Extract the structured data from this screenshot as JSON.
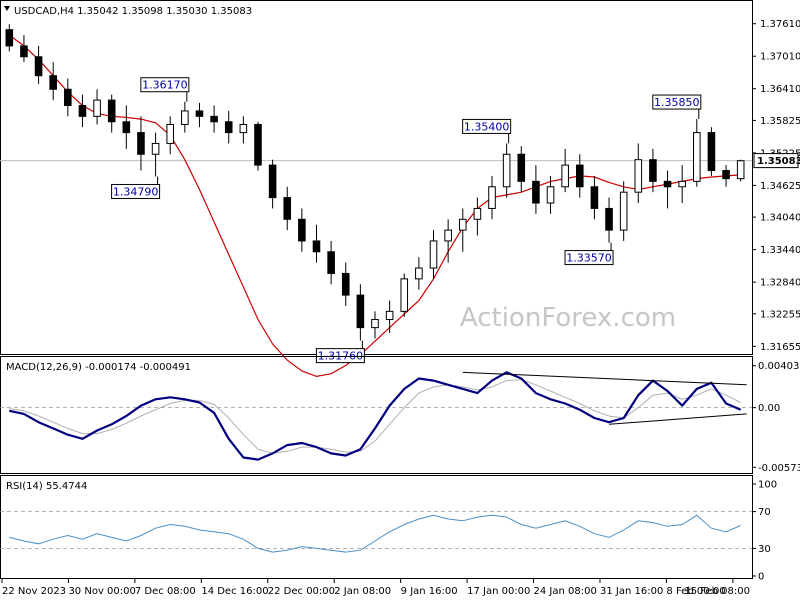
{
  "header": {
    "symbol_line": "USDCAD,H4  1.35042 1.35098 1.35030 1.35083"
  },
  "watermark": "ActionForex.com",
  "colors": {
    "ma": "#cc0000",
    "macd": "#000080",
    "signal": "#b0b0b0",
    "rsi": "#4a90c8",
    "trend": "#000000"
  },
  "chart_data": [
    {
      "type": "candlestick",
      "pane": "price",
      "ylim": [
        1.3155,
        1.379
      ],
      "y_ticks": [
        "1.37610",
        "1.37010",
        "1.36410",
        "1.35825",
        "1.35225",
        "1.34625",
        "1.34040",
        "1.33440",
        "1.32840",
        "1.32255",
        "1.31655"
      ],
      "current_price_label": "1.35083",
      "current_price": 1.35083,
      "series": [
        {
          "name": "Moving Average",
          "color": "#cc0000",
          "values": [
            1.374,
            1.372,
            1.3695,
            1.3665,
            1.3635,
            1.361,
            1.3595,
            1.359,
            1.3588,
            1.3585,
            1.3578,
            1.3555,
            1.351,
            1.3455,
            1.3395,
            1.3335,
            1.3275,
            1.3215,
            1.317,
            1.314,
            1.312,
            1.311,
            1.3115,
            1.313,
            1.315,
            1.3175,
            1.32,
            1.3225,
            1.325,
            1.329,
            1.334,
            1.3385,
            1.342,
            1.344,
            1.3445,
            1.345,
            1.346,
            1.347,
            1.3475,
            1.348,
            1.3478,
            1.3468,
            1.346,
            1.3455,
            1.346,
            1.3465,
            1.347,
            1.3475,
            1.3478,
            1.348,
            1.3482
          ]
        }
      ],
      "candles": [
        [
          1.375,
          1.376,
          1.371,
          1.372
        ],
        [
          1.372,
          1.374,
          1.369,
          1.37
        ],
        [
          1.37,
          1.372,
          1.365,
          1.3665
        ],
        [
          1.3665,
          1.369,
          1.362,
          1.364
        ],
        [
          1.364,
          1.366,
          1.359,
          1.361
        ],
        [
          1.361,
          1.363,
          1.357,
          1.359
        ],
        [
          1.359,
          1.364,
          1.3575,
          1.362
        ],
        [
          1.362,
          1.363,
          1.356,
          1.358
        ],
        [
          1.358,
          1.361,
          1.353,
          1.356
        ],
        [
          1.356,
          1.359,
          1.349,
          1.352
        ],
        [
          1.352,
          1.356,
          1.3479,
          1.354
        ],
        [
          1.354,
          1.359,
          1.352,
          1.3575
        ],
        [
          1.3575,
          1.3617,
          1.356,
          1.36
        ],
        [
          1.36,
          1.3615,
          1.357,
          1.359
        ],
        [
          1.359,
          1.361,
          1.356,
          1.358
        ],
        [
          1.358,
          1.36,
          1.354,
          1.356
        ],
        [
          1.356,
          1.359,
          1.354,
          1.3575
        ],
        [
          1.3575,
          1.358,
          1.349,
          1.35
        ],
        [
          1.35,
          1.351,
          1.342,
          1.344
        ],
        [
          1.344,
          1.346,
          1.338,
          1.34
        ],
        [
          1.34,
          1.342,
          1.334,
          1.336
        ],
        [
          1.336,
          1.339,
          1.332,
          1.334
        ],
        [
          1.334,
          1.336,
          1.328,
          1.33
        ],
        [
          1.33,
          1.332,
          1.324,
          1.326
        ],
        [
          1.326,
          1.328,
          1.3176,
          1.32
        ],
        [
          1.32,
          1.323,
          1.318,
          1.3215
        ],
        [
          1.3215,
          1.325,
          1.319,
          1.323
        ],
        [
          1.323,
          1.33,
          1.322,
          1.329
        ],
        [
          1.329,
          1.333,
          1.327,
          1.331
        ],
        [
          1.331,
          1.338,
          1.329,
          1.336
        ],
        [
          1.336,
          1.34,
          1.332,
          1.338
        ],
        [
          1.338,
          1.342,
          1.334,
          1.34
        ],
        [
          1.34,
          1.344,
          1.337,
          1.342
        ],
        [
          1.342,
          1.348,
          1.34,
          1.346
        ],
        [
          1.346,
          1.354,
          1.344,
          1.352
        ],
        [
          1.352,
          1.3535,
          1.345,
          1.347
        ],
        [
          1.347,
          1.35,
          1.341,
          1.343
        ],
        [
          1.343,
          1.348,
          1.341,
          1.346
        ],
        [
          1.346,
          1.353,
          1.345,
          1.35
        ],
        [
          1.35,
          1.352,
          1.344,
          1.346
        ],
        [
          1.346,
          1.348,
          1.34,
          1.342
        ],
        [
          1.342,
          1.344,
          1.3357,
          1.338
        ],
        [
          1.338,
          1.347,
          1.336,
          1.345
        ],
        [
          1.345,
          1.354,
          1.343,
          1.351
        ],
        [
          1.351,
          1.353,
          1.345,
          1.347
        ],
        [
          1.347,
          1.349,
          1.342,
          1.346
        ],
        [
          1.346,
          1.35,
          1.343,
          1.347
        ],
        [
          1.347,
          1.3585,
          1.346,
          1.356
        ],
        [
          1.356,
          1.357,
          1.348,
          1.349
        ],
        [
          1.349,
          1.35,
          1.346,
          1.3475
        ],
        [
          1.3475,
          1.351,
          1.347,
          1.3508
        ]
      ],
      "annotations": [
        {
          "label": "1.36170",
          "candle": 12,
          "side": "top"
        },
        {
          "label": "1.34790",
          "candle": 10,
          "side": "bottom"
        },
        {
          "label": "1.31760",
          "candle": 24,
          "side": "bottom"
        },
        {
          "label": "1.35400",
          "candle": 34,
          "side": "top"
        },
        {
          "label": "1.33570",
          "candle": 41,
          "side": "bottom"
        },
        {
          "label": "1.35850",
          "candle": 47,
          "side": "top"
        }
      ]
    },
    {
      "type": "line",
      "pane": "macd",
      "indicator_label": "MACD(12,26,9) -0.000174 -0.000491",
      "ylim": [
        -0.006,
        0.0042
      ],
      "y_ticks": [
        "0.004038",
        "0.00",
        "-0.005737"
      ],
      "series": [
        {
          "name": "MACD",
          "color": "#000080",
          "values": [
            -0.0003,
            -0.0006,
            -0.0014,
            -0.002,
            -0.0026,
            -0.003,
            -0.0022,
            -0.0016,
            -0.0008,
            0.0002,
            0.0008,
            0.001,
            0.0008,
            0.0005,
            -0.0005,
            -0.003,
            -0.0048,
            -0.005,
            -0.0044,
            -0.0036,
            -0.0034,
            -0.0038,
            -0.0044,
            -0.0046,
            -0.004,
            -0.002,
            0.0002,
            0.0018,
            0.0028,
            0.0026,
            0.0022,
            0.0018,
            0.0014,
            0.0026,
            0.0034,
            0.0028,
            0.0014,
            0.0008,
            0.0004,
            -0.0002,
            -0.001,
            -0.0014,
            -0.001,
            0.0012,
            0.0026,
            0.0016,
            0.0002,
            0.0018,
            0.0024,
            0.0004,
            -0.0002
          ]
        },
        {
          "name": "Signal",
          "color": "#b0b0b0",
          "values": [
            -0.0001,
            -0.0003,
            -0.0008,
            -0.0014,
            -0.002,
            -0.0025,
            -0.0025,
            -0.0021,
            -0.0015,
            -0.0008,
            -0.0002,
            0.0004,
            0.0007,
            0.0007,
            0.0003,
            -0.001,
            -0.0026,
            -0.004,
            -0.0044,
            -0.0042,
            -0.0038,
            -0.0038,
            -0.004,
            -0.0043,
            -0.0042,
            -0.0032,
            -0.0016,
            0.0,
            0.0014,
            0.002,
            0.0022,
            0.002,
            0.0017,
            0.002,
            0.0026,
            0.0027,
            0.0022,
            0.0016,
            0.001,
            0.0004,
            -0.0003,
            -0.0008,
            -0.001,
            0.0,
            0.0012,
            0.0014,
            0.0008,
            0.0012,
            0.0018,
            0.0012,
            0.0005
          ]
        }
      ],
      "trendlines": [
        {
          "from_candle": 31,
          "from_value": 0.0034,
          "to_candle": 50,
          "to_value": 0.0022
        },
        {
          "from_candle": 41,
          "from_value": -0.0016,
          "to_candle": 50,
          "to_value": -0.0006
        }
      ]
    },
    {
      "type": "line",
      "pane": "rsi",
      "indicator_label": "RSI(14) 55.4744",
      "ylim": [
        0,
        100
      ],
      "y_ticks": [
        "100",
        "70",
        "30",
        "0"
      ],
      "levels": [
        70,
        30
      ],
      "series": [
        {
          "name": "RSI",
          "color": "#4a90c8",
          "values": [
            42,
            38,
            35,
            40,
            44,
            40,
            46,
            42,
            38,
            44,
            52,
            56,
            54,
            50,
            48,
            46,
            40,
            30,
            26,
            28,
            32,
            30,
            28,
            26,
            28,
            38,
            48,
            56,
            62,
            66,
            62,
            60,
            64,
            66,
            64,
            56,
            52,
            56,
            60,
            54,
            46,
            42,
            50,
            60,
            58,
            54,
            56,
            66,
            52,
            48,
            55
          ]
        }
      ]
    }
  ],
  "x_axis": {
    "labels": [
      "22 Nov 2023",
      "30 Nov 00:00",
      "7 Dec 08:00",
      "14 Dec 16:00",
      "22 Dec 00:00",
      "2 Jan 08:00",
      "9 Jan 16:00",
      "17 Jan 00:00",
      "24 Jan 08:00",
      "31 Jan 16:00",
      "8 Feb 00:00",
      "15 Feb 08:00"
    ]
  }
}
